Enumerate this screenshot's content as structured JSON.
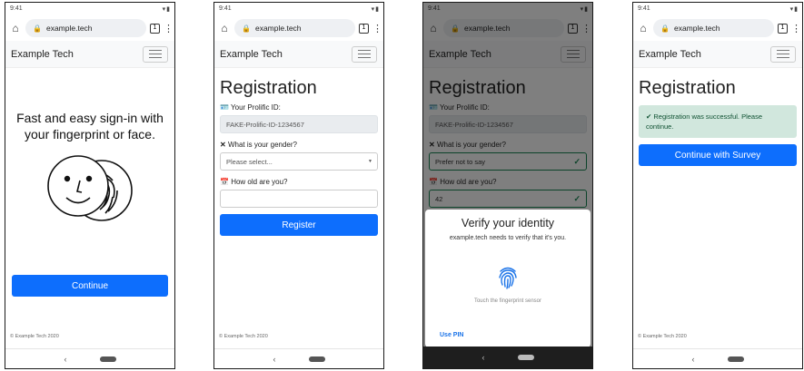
{
  "status": {
    "time": "9:41",
    "icons": "▾▮"
  },
  "browser": {
    "url": "example.tech",
    "tab_count": "1"
  },
  "brand": "Example Tech",
  "footer": "© Example Tech 2020",
  "screen1": {
    "headline": "Fast and easy sign-in with your fingerprint or face.",
    "continue_label": "Continue"
  },
  "form": {
    "title": "Registration",
    "id_label": "Your Prolific ID:",
    "id_value": "FAKE-Prolific-ID-1234567",
    "gender_label": "What is your gender?",
    "gender_placeholder": "Please select...",
    "gender_selected": "Prefer not to say",
    "age_label": "How old are you?",
    "age_value": "42",
    "register_label": "Register"
  },
  "verify": {
    "title": "Verify your identity",
    "subtitle": "example.tech needs to verify that it's you.",
    "hint": "Touch the fingerprint sensor",
    "use_pin": "Use PIN"
  },
  "success": {
    "message": "Registration was successful. Please continue.",
    "survey_label": "Continue with Survey"
  },
  "colors": {
    "primary": "#0d6efd",
    "success": "#198754",
    "success_bg": "#d1e7dd",
    "sheet_link": "#1a73e8"
  }
}
